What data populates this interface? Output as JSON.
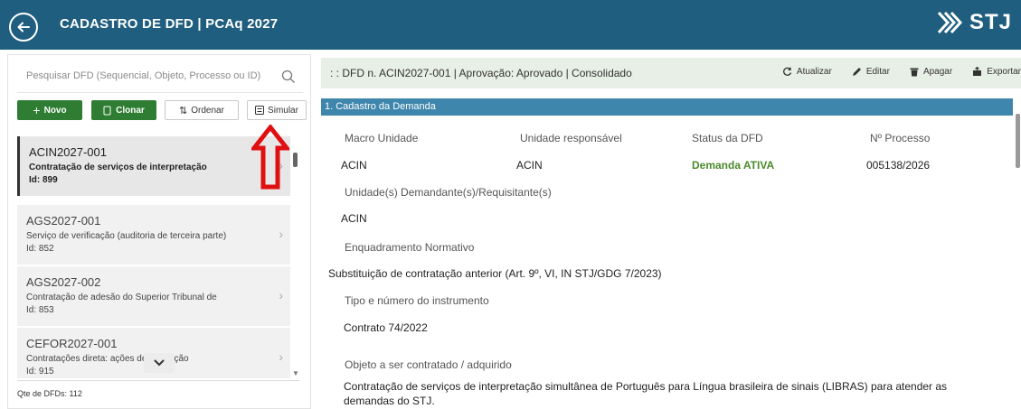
{
  "header": {
    "title": "CADASTRO DE DFD | PCAq 2027",
    "logo_text": "STJ"
  },
  "search": {
    "placeholder": "Pesquisar DFD (Sequencial, Objeto, Processo ou ID)"
  },
  "buttons": {
    "novo": "Novo",
    "clonar": "Clonar",
    "ordenar": "Ordenar",
    "simular": "Simular"
  },
  "list": [
    {
      "code": "ACIN2027-001",
      "desc": "Contratação de serviços de interpretação",
      "id": "Id: 899"
    },
    {
      "code": "AGS2027-001",
      "desc": "Serviço de verificação (auditoria de terceira parte)",
      "id": "Id: 852"
    },
    {
      "code": "AGS2027-002",
      "desc": "Contratação de adesão do Superior Tribunal de",
      "id": "Id: 853"
    },
    {
      "code": "CEFOR2027-001",
      "desc": "Contratações direta: ações de educação",
      "id": "Id: 915"
    }
  ],
  "count_label": "Qte de DFDs: 112",
  "info_bar": {
    "text": ": : DFD n. ACIN2027-001 | Aprovação: Aprovado | Consolidado",
    "actions": [
      "Atualizar",
      "Editar",
      "Apagar",
      "Exportar"
    ]
  },
  "section": {
    "title": "1. Cadastro da Demanda",
    "macro_label": "Macro Unidade",
    "macro_value": "ACIN",
    "unidade_label": "Unidade responsável",
    "unidade_value": "ACIN",
    "status_label": "Status da DFD",
    "status_value": "Demanda ATIVA",
    "processo_label": "Nº Processo",
    "processo_value": "005138/2026",
    "demandante_label": "Unidade(s) Demandante(s)/Requisitante(s)",
    "demandante_value": "ACIN",
    "enquadramento_label": "Enquadramento Normativo",
    "enquadramento_value": "Substituição de contratação anterior (Art. 9º, VI, IN STJ/GDG 7/2023)",
    "instrumento_label": "Tipo e número do instrumento",
    "instrumento_value": "Contrato 74/2022",
    "objeto_label": "Objeto a ser contratado / adquirido",
    "objeto_value_1": "Contratação de serviços de interpretação simultânea de Português para Língua brasileira de sinais (LIBRAS) para atender as",
    "objeto_value_2": "demandas do STJ."
  },
  "colors": {
    "header": "#1f5e7e",
    "section": "#3f86ad",
    "green": "#2e7d32",
    "status": "#4a8a2a",
    "annotation": "#e01010"
  }
}
